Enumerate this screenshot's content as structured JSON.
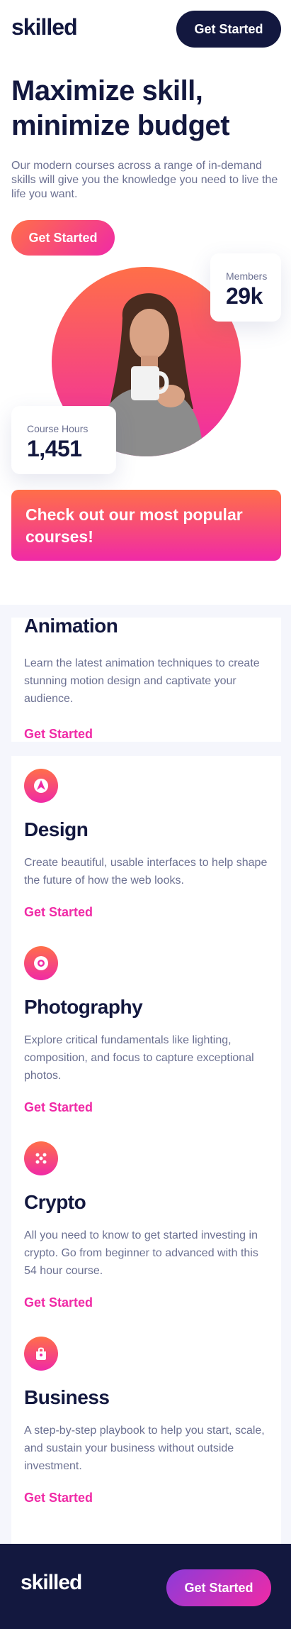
{
  "header": {
    "logo": "skilled",
    "cta": "Get Started"
  },
  "hero": {
    "title": "Maximize skill, minimize budget",
    "text": "Our modern courses across a range of in-demand skills will give you the knowledge you need to live the life you want.",
    "cta": "Get Started",
    "members": {
      "label": "Members",
      "value": "29k"
    },
    "hours": {
      "label": "Course Hours",
      "value": "1,451"
    }
  },
  "popular": {
    "text": "Check out our most popular courses!"
  },
  "courses": [
    {
      "title": "Animation",
      "icon": "animation-icon",
      "desc": "Learn the latest animation techniques to create stunning motion design and captivate your audience.",
      "link": "Get Started"
    },
    {
      "title": "Design",
      "icon": "design-icon",
      "desc": "Create beautiful, usable interfaces to help shape the future of how the web looks.",
      "link": "Get Started"
    },
    {
      "title": "Photography",
      "icon": "camera-icon",
      "desc": "Explore critical fundamentals like lighting, composition, and focus to capture exceptional photos.",
      "link": "Get Started"
    },
    {
      "title": "Crypto",
      "icon": "crypto-icon",
      "desc": "All you need to know to get started investing in crypto. Go from beginner to advanced with this 54 hour course.",
      "link": "Get Started"
    },
    {
      "title": "Business",
      "icon": "business-icon",
      "desc": "A step-by-step playbook to help you start, scale, and sustain your business without outside investment.",
      "link": "Get Started"
    }
  ],
  "footer": {
    "logo": "skilled",
    "cta": "Get Started"
  },
  "colors": {
    "navy": "#13183f",
    "pink": "#f02aa6",
    "orange": "#ff6f48",
    "purple": "#8d3bd9",
    "gray": "#6c7192"
  }
}
